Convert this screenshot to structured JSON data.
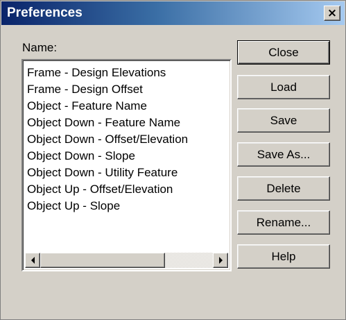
{
  "window": {
    "title": "Preferences",
    "close_glyph": "×"
  },
  "name_label": "Name:",
  "list": {
    "items": [
      "Frame - Design Elevations",
      "Frame - Design Offset",
      "Object - Feature Name",
      "Object Down - Feature Name",
      "Object Down - Offset/Elevation",
      "Object Down - Slope",
      "Object Down - Utility Feature",
      "Object Up - Offset/Elevation",
      "Object Up - Slope"
    ]
  },
  "buttons": {
    "close": "Close",
    "load": "Load",
    "save": "Save",
    "save_as": "Save As...",
    "delete": "Delete",
    "rename": "Rename...",
    "help": "Help"
  }
}
